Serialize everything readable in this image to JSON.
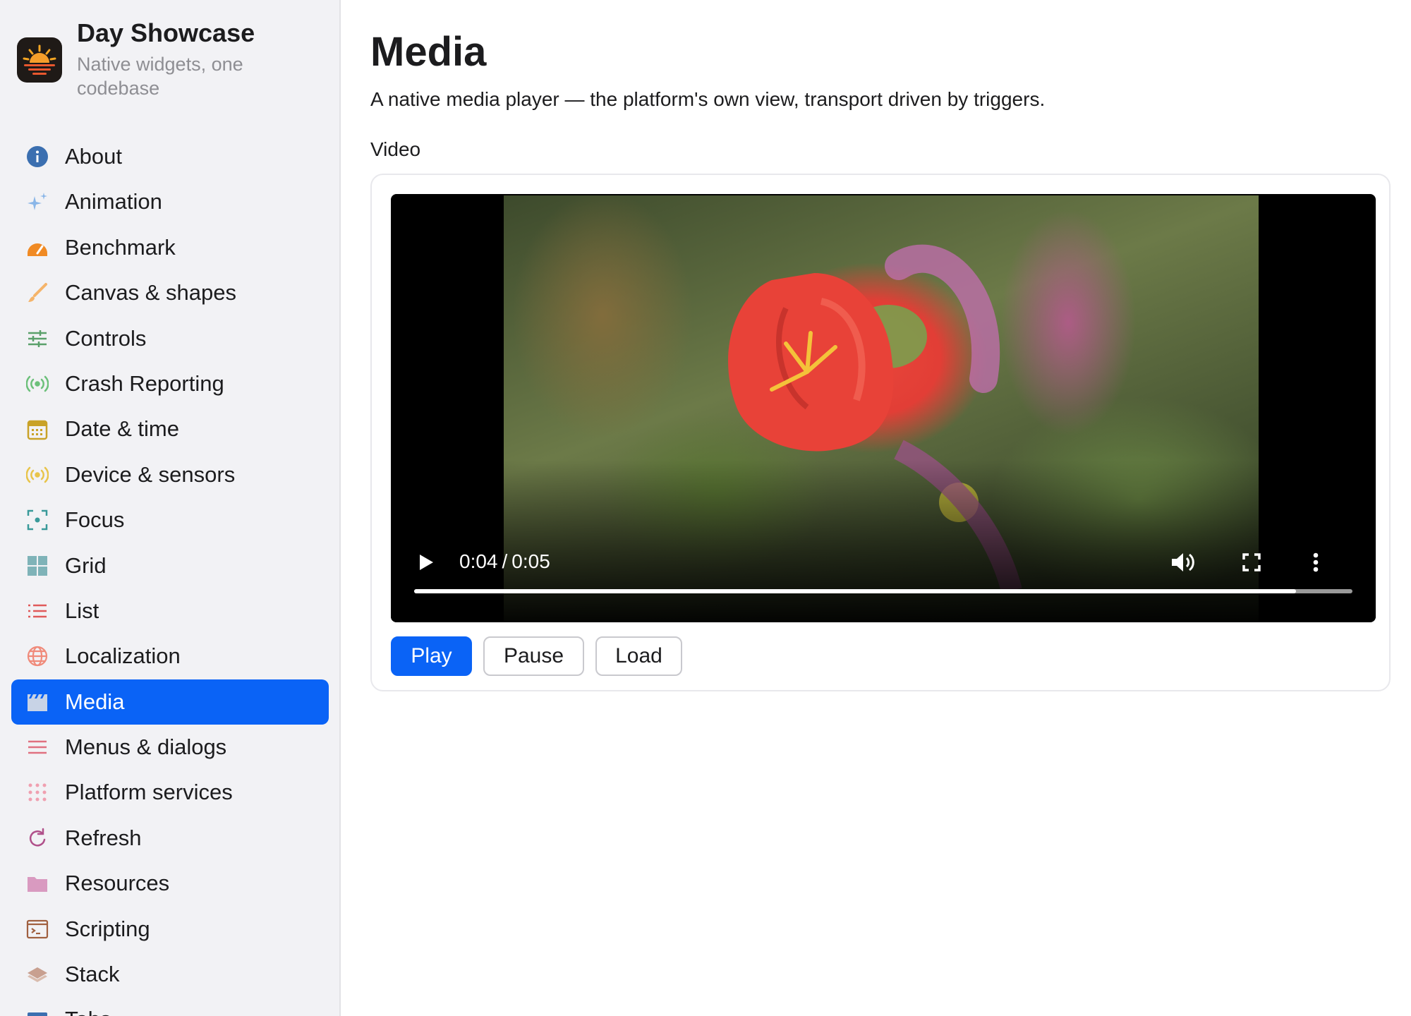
{
  "app": {
    "title": "Day Showcase",
    "subtitle": "Native widgets, one codebase",
    "icon": "sunset-app-icon"
  },
  "sidebar": {
    "items": [
      {
        "label": "About",
        "icon": "info-icon",
        "color": "#3b6fb0"
      },
      {
        "label": "Animation",
        "icon": "sparkles-icon",
        "color": "#8ab6e8"
      },
      {
        "label": "Benchmark",
        "icon": "gauge-icon",
        "color": "#f08a24"
      },
      {
        "label": "Canvas & shapes",
        "icon": "brush-icon",
        "color": "#f5b46a"
      },
      {
        "label": "Controls",
        "icon": "sliders-icon",
        "color": "#5aa06a"
      },
      {
        "label": "Crash Reporting",
        "icon": "broadcast-icon",
        "color": "#6cc07a"
      },
      {
        "label": "Date & time",
        "icon": "calendar-icon",
        "color": "#c9a227"
      },
      {
        "label": "Device & sensors",
        "icon": "sensor-icon",
        "color": "#e8c44a"
      },
      {
        "label": "Focus",
        "icon": "focus-icon",
        "color": "#3a9a9a"
      },
      {
        "label": "Grid",
        "icon": "grid-icon",
        "color": "#7fb3b8"
      },
      {
        "label": "List",
        "icon": "list-icon",
        "color": "#e05a5a"
      },
      {
        "label": "Localization",
        "icon": "globe-icon",
        "color": "#f08a7a"
      },
      {
        "label": "Media",
        "icon": "clapperboard-icon",
        "color": "#ffffff",
        "active": true
      },
      {
        "label": "Menus & dialogs",
        "icon": "menu-icon",
        "color": "#e07080"
      },
      {
        "label": "Platform services",
        "icon": "dots-grid-icon",
        "color": "#f0a0b0"
      },
      {
        "label": "Refresh",
        "icon": "refresh-icon",
        "color": "#b0508a"
      },
      {
        "label": "Resources",
        "icon": "folder-icon",
        "color": "#d99ac0"
      },
      {
        "label": "Scripting",
        "icon": "terminal-icon",
        "color": "#a06040"
      },
      {
        "label": "Stack",
        "icon": "layers-icon",
        "color": "#c8a090"
      },
      {
        "label": "Tabs",
        "icon": "tabs-icon",
        "color": "#3b6fb0"
      }
    ]
  },
  "main": {
    "title": "Media",
    "description": "A native media player — the platform's own view, transport driven by triggers.",
    "section_label": "Video",
    "player": {
      "current_time": "0:04",
      "duration": "0:05",
      "progress": 0.94
    },
    "buttons": {
      "play": "Play",
      "pause": "Pause",
      "load": "Load"
    }
  },
  "colors": {
    "accent": "#0a63f6",
    "sidebar_bg": "#f2f2f5"
  }
}
